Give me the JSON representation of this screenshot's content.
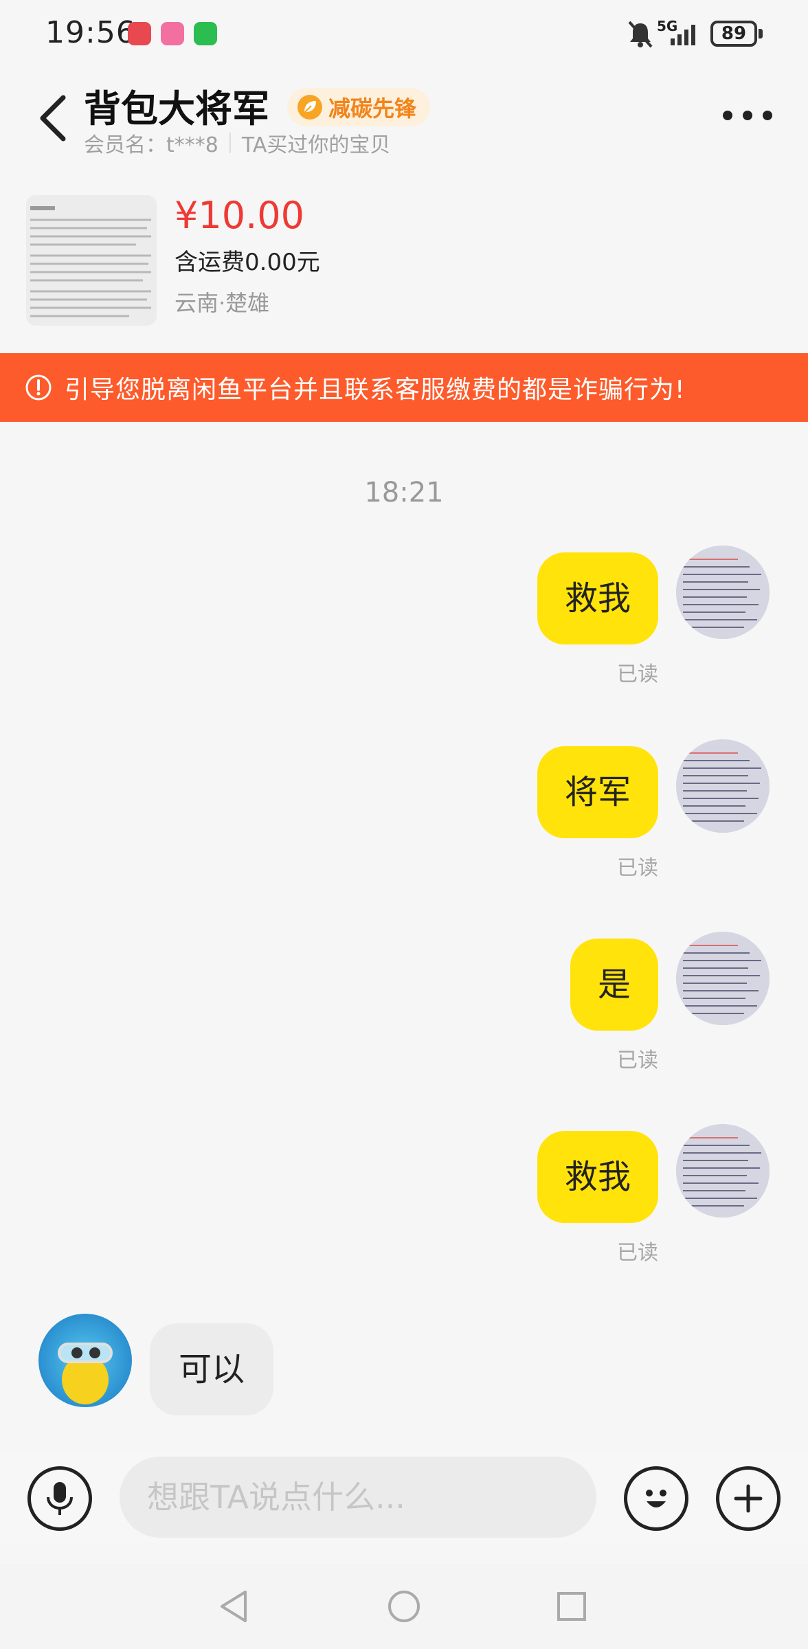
{
  "status_bar": {
    "time": "19:56",
    "battery": "89",
    "signal_label": "5G"
  },
  "header": {
    "seller_name": "背包大将军",
    "badge_label": "减碳先锋",
    "member_label": "会员名：t***8",
    "relation_label": "TA买过你的宝贝"
  },
  "product": {
    "price": "¥10.00",
    "shipping": "含运费0.00元",
    "location": "云南·楚雄"
  },
  "warning": {
    "text": "引导您脱离闲鱼平台并且联系客服缴费的都是诈骗行为!"
  },
  "chat": {
    "timestamp": "18:21",
    "outgoing": [
      {
        "text": "救我",
        "status": "已读"
      },
      {
        "text": "将军",
        "status": "已读"
      },
      {
        "text": "是",
        "status": "已读"
      },
      {
        "text": "救我",
        "status": "已读"
      }
    ],
    "incoming": [
      {
        "text": "可以"
      }
    ]
  },
  "input": {
    "placeholder": "想跟TA说点什么..."
  },
  "colors": {
    "bubble_out": "#ffe30a",
    "warning_bg": "#fd5b2b",
    "price": "#ee3a34",
    "badge_text": "#f2841a"
  },
  "icons": [
    "back-arrow-icon",
    "leaf-icon",
    "more-icon",
    "warning-icon",
    "microphone-icon",
    "emoji-icon",
    "plus-icon",
    "nav-back-icon",
    "nav-home-icon",
    "nav-recents-icon"
  ]
}
